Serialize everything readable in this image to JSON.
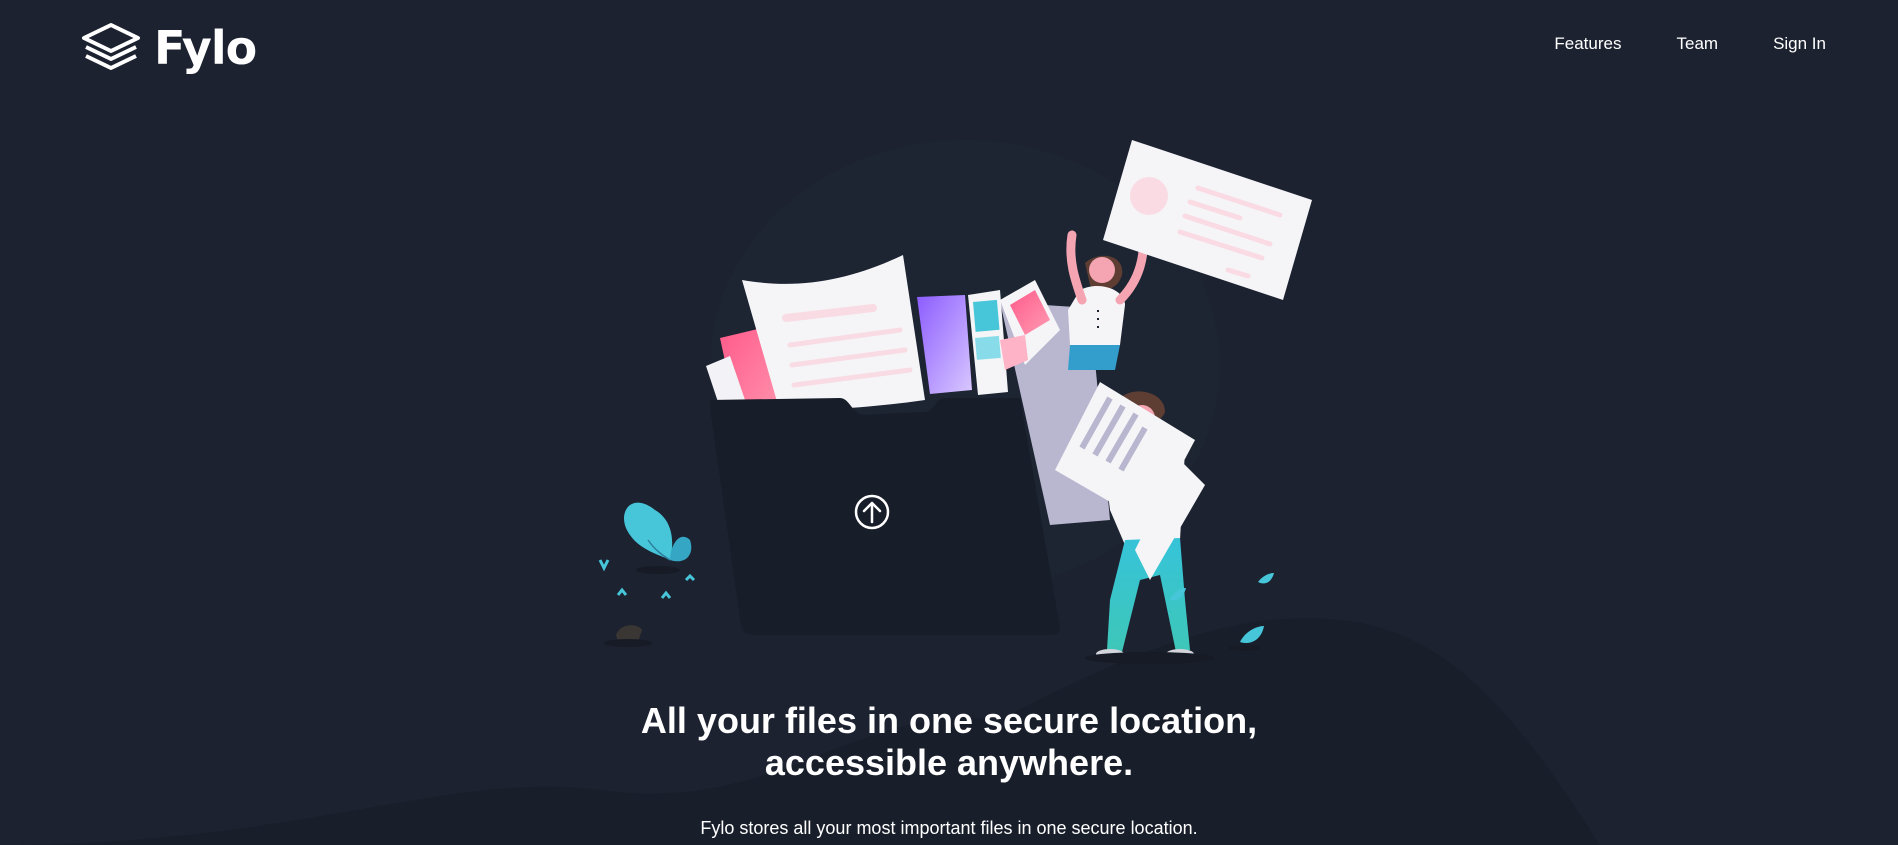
{
  "header": {
    "logo_text": "Fylo",
    "logo_icon": "stacked-layers-icon",
    "nav": [
      {
        "label": "Features"
      },
      {
        "label": "Team"
      },
      {
        "label": "Sign In"
      }
    ]
  },
  "hero": {
    "title_line1": "All your files in one secure location,",
    "title_line2": "accessible anywhere.",
    "subtitle": "Fylo stores all your most important files in one secure location.",
    "upload_icon": "upload-arrow-icon"
  },
  "colors": {
    "background": "#1c2230",
    "curve": "#181e2a",
    "folder": "#171d29",
    "accent_cyan": "#65e2d9",
    "accent_blue": "#339ecc",
    "text": "#ffffff"
  }
}
